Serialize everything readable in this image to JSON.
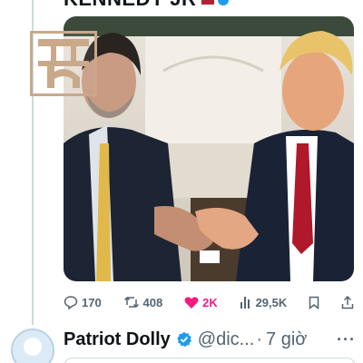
{
  "tweet": {
    "author_name_partial": "KENNEDY JR",
    "media_alt": "Photo of two men shaking hands in an office",
    "stats": {
      "replies": "170",
      "retweets": "408",
      "likes": "2K",
      "views": "29,5K"
    },
    "icons": {
      "reply": "reply-icon",
      "retweet": "retweet-icon",
      "like": "heart-icon",
      "views": "views-icon",
      "bookmark": "bookmark-icon",
      "share": "share-icon"
    },
    "like_color": "#f91880"
  },
  "next_tweet": {
    "display_name": "Patriot Dolly",
    "handle": "@dic...",
    "separator": "·",
    "time": "7 giờ",
    "more": "···"
  },
  "colors": {
    "verified": "#1d9bf0",
    "secondary_text": "#536471"
  }
}
